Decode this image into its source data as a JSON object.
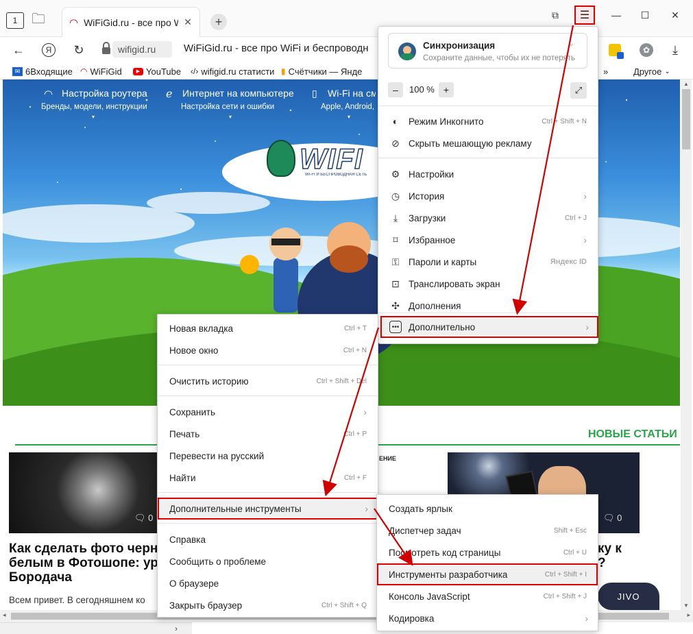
{
  "titlebar": {
    "tab_badge_count": "1",
    "tab_title": "WiFiGid.ru - все про WiFi",
    "new_tab_symbol": "+"
  },
  "addressbar": {
    "back_icon": "arrow-left-icon",
    "yandex_icon": "yandex-icon",
    "reload_icon": "reload-icon",
    "url": "wifigid.ru",
    "page_title": "WiFiGid.ru - все про WiFi и беспроводн"
  },
  "bookmarks": [
    {
      "label": "6Входящие"
    },
    {
      "label": "WiFiGid"
    },
    {
      "label": "YouTube"
    },
    {
      "label": "wifigid.ru статисти"
    },
    {
      "label": "Счётчики — Янде"
    }
  ],
  "bookmarks_more": "»",
  "bookmarks_other": "Другое",
  "site": {
    "links": [
      {
        "title": "Настройка роутера",
        "sub": "Бренды, модели, инструкции"
      },
      {
        "title": "Интернет на компьютере",
        "sub": "Настройка сети и ошибки"
      },
      {
        "title": "Wi-Fi на см",
        "sub": "Apple, Android,"
      }
    ],
    "logo_text": "WIFI",
    "logo_sub": "WI-FI И БЕСПРОВОДНАЯ СЕТЬ",
    "new_articles": "НОВЫЕ СТАТЬИ",
    "article_title": "Как сделать фото черн белым в Фотошопе: ур Бородача",
    "article_body": "Всем привет. В сегодняшнем ко",
    "comment_count_1": "0",
    "comment_count_2": "0",
    "article2_frag": "ку к",
    "article2_frag2": "?",
    "jivo": "JIVO"
  },
  "main_menu": {
    "sync_title": "Синхронизация",
    "sync_sub": "Сохраните данные, чтобы их не потерять",
    "zoom_minus": "–",
    "zoom_value": "100 %",
    "zoom_plus": "+",
    "items": [
      {
        "label": "Режим Инкогнито",
        "shortcut": "Ctrl + Shift + N",
        "icon": "incognito-icon"
      },
      {
        "label": "Скрыть мешающую рекламу",
        "shortcut": "",
        "icon": "block-ads-icon"
      },
      {
        "label": "Настройки",
        "shortcut": "",
        "icon": "gear-icon"
      },
      {
        "label": "История",
        "shortcut": "",
        "icon": "clock-icon",
        "arrow": true
      },
      {
        "label": "Загрузки",
        "shortcut": "Ctrl + J",
        "icon": "download-icon"
      },
      {
        "label": "Избранное",
        "shortcut": "",
        "icon": "bookmark-icon",
        "arrow": true
      },
      {
        "label": "Пароли и карты",
        "shortcut": "Яндекс ID",
        "icon": "key-icon"
      },
      {
        "label": "Транслировать экран",
        "shortcut": "",
        "icon": "cast-icon"
      },
      {
        "label": "Дополнения",
        "shortcut": "",
        "icon": "puzzle-icon"
      },
      {
        "label": "Дополнительно",
        "shortcut": "",
        "icon": "more-icon",
        "arrow": true
      }
    ]
  },
  "more_menu": {
    "items": [
      {
        "label": "Новая вкладка",
        "shortcut": "Ctrl + T"
      },
      {
        "label": "Новое окно",
        "shortcut": "Ctrl + N"
      },
      {
        "label": "Очистить историю",
        "shortcut": "Ctrl + Shift + Del"
      },
      {
        "label": "Сохранить",
        "shortcut": "",
        "arrow": true
      },
      {
        "label": "Печать",
        "shortcut": "Ctrl + P"
      },
      {
        "label": "Перевести на русский",
        "shortcut": ""
      },
      {
        "label": "Найти",
        "shortcut": "Ctrl + F"
      },
      {
        "label": "Дополнительные инструменты",
        "shortcut": "",
        "arrow": true
      },
      {
        "label": "Справка",
        "shortcut": ""
      },
      {
        "label": "Сообщить о проблеме",
        "shortcut": ""
      },
      {
        "label": "О браузере",
        "shortcut": ""
      },
      {
        "label": "Закрыть браузер",
        "shortcut": "Ctrl + Shift + Q"
      }
    ]
  },
  "tools_menu": {
    "items": [
      {
        "label": "Создать ярлык",
        "shortcut": ""
      },
      {
        "label": "Диспетчер задач",
        "shortcut": "Shift + Esc"
      },
      {
        "label": "Посмотреть код страницы",
        "shortcut": "Ctrl + U"
      },
      {
        "label": "Инструменты разработчика",
        "shortcut": "Ctrl + Shift + I"
      },
      {
        "label": "Консоль JavaScript",
        "shortcut": "Ctrl + Shift + J"
      },
      {
        "label": "Кодировка",
        "shortcut": "",
        "arrow": true
      }
    ]
  },
  "colors": {
    "highlight": "#d00000",
    "accent_green": "#2aa34a"
  }
}
